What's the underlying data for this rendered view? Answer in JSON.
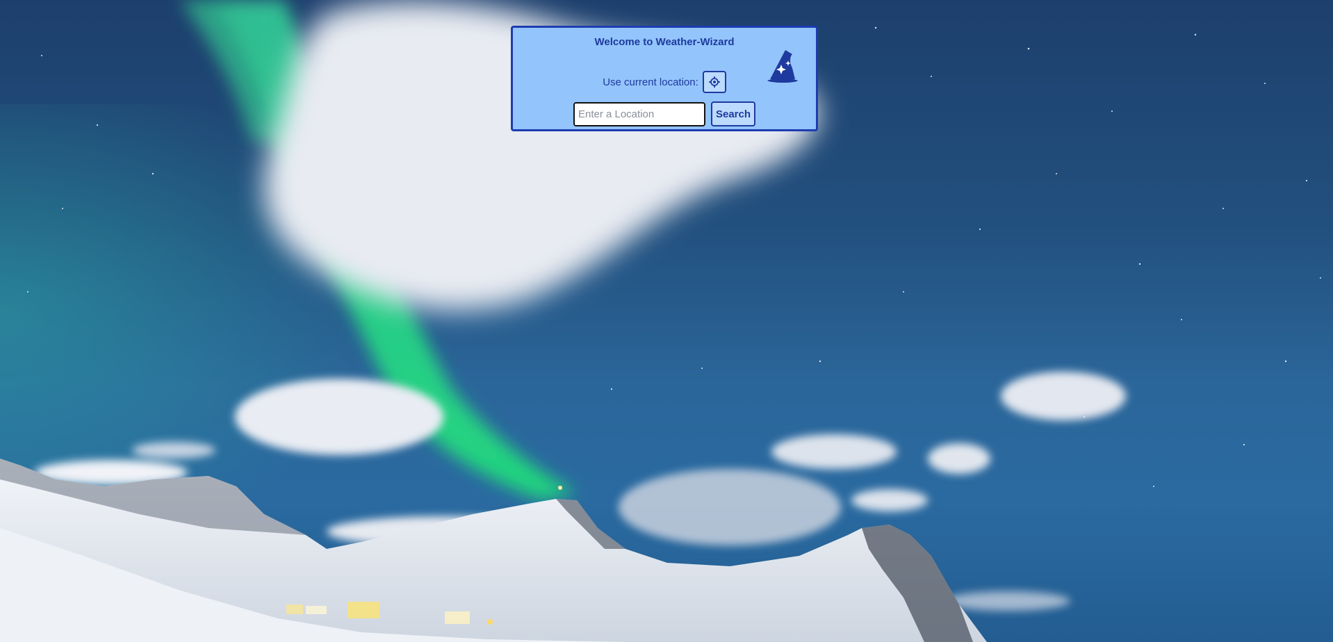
{
  "app": {
    "title": "Welcome to Weather-Wizard"
  },
  "location": {
    "label": "Use current location:",
    "button_icon": "crosshair-icon"
  },
  "search": {
    "placeholder": "Enter a Location",
    "value": "",
    "button_label": "Search"
  },
  "branding": {
    "icon": "wizard-hat-icon"
  },
  "colors": {
    "panel_background": "#93c4fb",
    "panel_border": "#1d3cb0",
    "accent_text": "#1e3a9e",
    "button_background": "#bcdafd"
  },
  "background": {
    "scene": "aurora-night-sky-snowy-mountains"
  }
}
